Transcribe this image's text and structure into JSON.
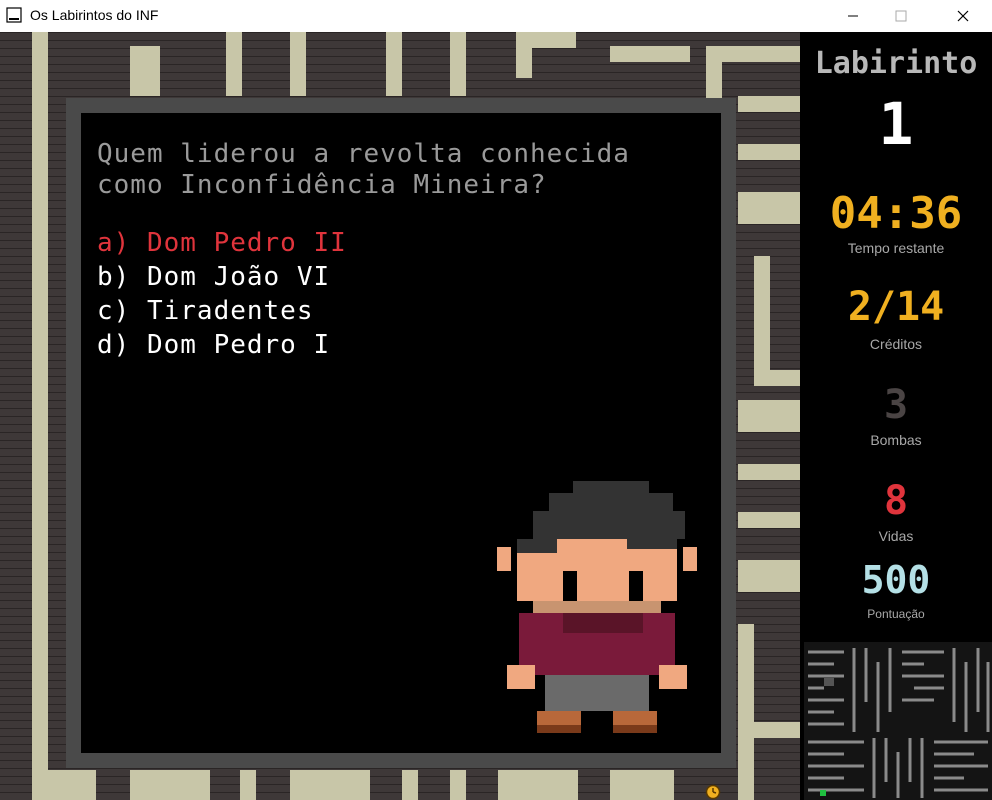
{
  "window": {
    "title": "Os Labirintos do INF"
  },
  "question": {
    "text": "Quem liderou a revolta conhecida como Inconfidência Mineira?",
    "answers": [
      {
        "label": "a) Dom Pedro II",
        "selected": true
      },
      {
        "label": "b) Dom João VI",
        "selected": false
      },
      {
        "label": "c) Tiradentes",
        "selected": false
      },
      {
        "label": "d) Dom Pedro I",
        "selected": false
      }
    ]
  },
  "hud": {
    "title": "Labirinto",
    "level": "1",
    "time": {
      "value": "04:36",
      "label": "Tempo restante"
    },
    "credits": {
      "value": "2/14",
      "label": "Créditos"
    },
    "bombs": {
      "value": "3",
      "label": "Bombas"
    },
    "lives": {
      "value": "8",
      "label": "Vidas"
    },
    "score": {
      "value": "500",
      "label": "Pontuação"
    }
  },
  "colors": {
    "selected_answer": "#e0343c",
    "time": "#f0b020",
    "credits": "#f0b020",
    "bombs": "#4a4444",
    "lives": "#e0343c",
    "score": "#b4e0e6",
    "maze_path": "#c8c6a8",
    "maze_wall": "#3e3838"
  },
  "icons": [
    "app-icon",
    "minimize-icon",
    "maximize-icon",
    "close-icon",
    "clock-icon",
    "player-character",
    "minimap"
  ]
}
